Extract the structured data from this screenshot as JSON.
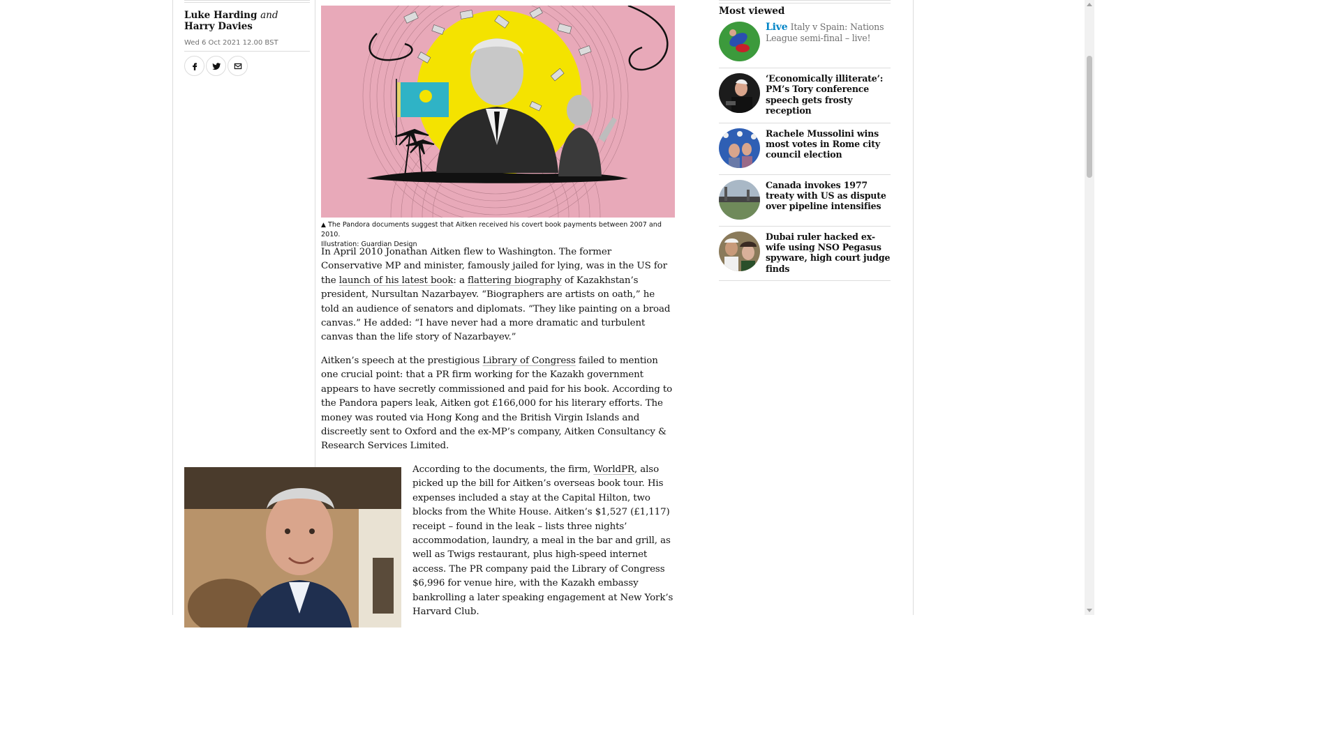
{
  "byline": {
    "author1": "Luke Harding",
    "and": "and",
    "author2": "Harry Davies"
  },
  "dateline": "Wed 6 Oct 2021 12.00 BST",
  "share": {
    "icons": [
      "facebook-icon",
      "twitter-icon",
      "email-icon"
    ]
  },
  "hero": {
    "caption": "The Pandora documents suggest that Aitken received his covert book payments between 2007 and 2010.",
    "credit": "Illustration: Guardian Design",
    "caption_icon": "▲"
  },
  "article": {
    "p1_a": "In April 2010 Jonathan Aitken flew to Washington. The former Conservative MP and minister, famously jailed for lying, was in the US for the ",
    "p1_link1": "launch of his latest book",
    "p1_b": ": a ",
    "p1_link2": "flattering biography",
    "p1_c": " of Kazakhstan’s president, Nursultan Nazarbayev. “Biographers are artists on oath,” he told an audience of senators and diplomats. “They like painting on a broad canvas.” He added: “I have never had a more dramatic and turbulent canvas than the life story of Nazarbayev.”",
    "p2_a": "Aitken’s speech at the prestigious ",
    "p2_link": "Library of Congress",
    "p2_b": " failed to mention one crucial point: that a PR firm working for the Kazakh government appears to have secretly commissioned and paid for his book. According to the Pandora papers leak, Aitken got £166,000 for his literary efforts. The money was routed via Hong Kong and the British Virgin Islands and discreetly sent to Oxford and the ex-MP’s company, Aitken Consultancy & Research Services Limited.",
    "p3_a": "According to the documents, the firm, ",
    "p3_link": "WorldPR",
    "p3_b": ", also picked up the bill for Aitken’s overseas book tour. His expenses included a stay at the Capital Hilton, two blocks from the White House. Aitken’s $1,527 (£1,117) receipt – found in the leak – lists three nights’ accommodation, laundry, a meal in the bar and grill, as well as Twigs restaurant, plus high-speed internet access. The PR company paid the Library of Congress $6,996 for venue hire, with the Kazakh embassy bankrolling a later speaking engagement at New York’s Harvard Club."
  },
  "most_viewed": {
    "title": "Most viewed",
    "items": [
      {
        "kicker": "Live",
        "headline": "Italy v Spain: Nations League semi-final – live!"
      },
      {
        "kicker": "",
        "headline": "‘Economically illiterate’: PM’s Tory conference speech gets frosty reception"
      },
      {
        "kicker": "",
        "headline": "Rachele Mussolini wins most votes in Rome city council election"
      },
      {
        "kicker": "",
        "headline": "Canada invokes 1977 treaty with US as dispute over pipeline intensifies"
      },
      {
        "kicker": "",
        "headline": "Dubai ruler hacked ex-wife using NSO Pegasus spyware, high court judge finds"
      }
    ]
  },
  "colors": {
    "live_kicker": "#0084c6",
    "hero_background": "#e8a9b9",
    "sun": "#f4e300",
    "rule": "#dcdcdc"
  }
}
